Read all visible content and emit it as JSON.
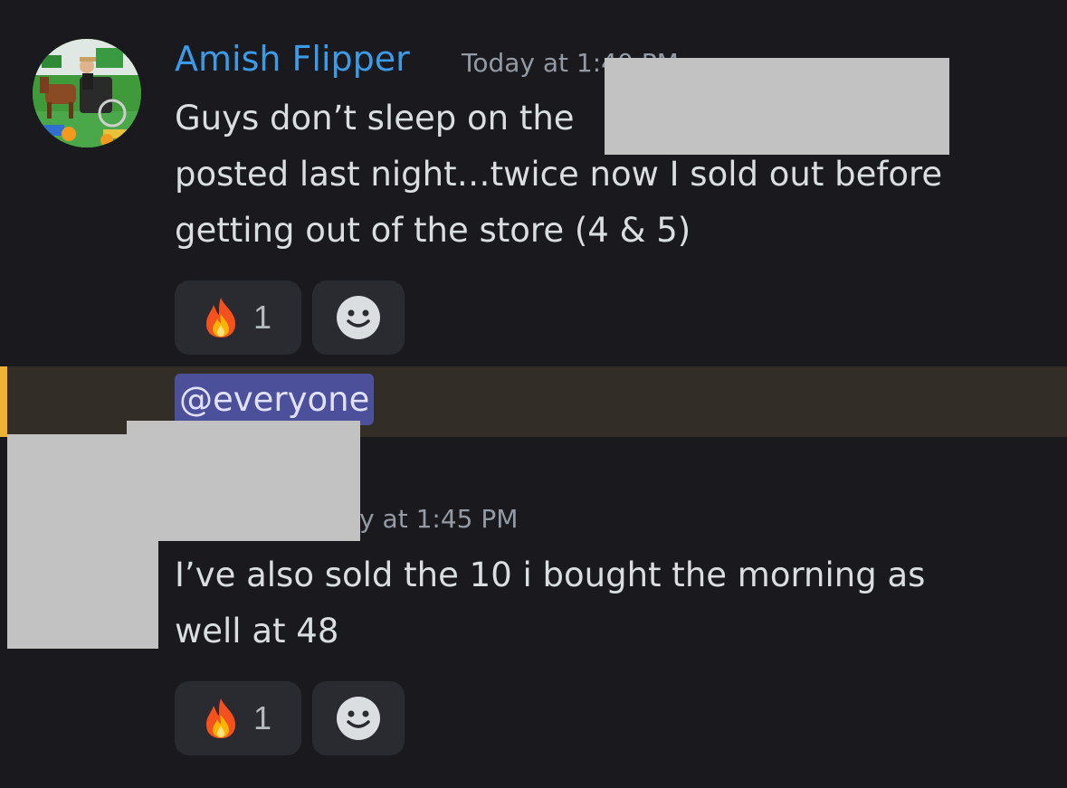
{
  "message1": {
    "author": "Amish Flipper",
    "timestamp": "Today at 1:40 PM",
    "line1": "Guys don’t sleep on the",
    "line2": "posted last night…twice now I sold out before",
    "line3": "getting out of the store (4 & 5)",
    "reaction": {
      "emoji": "fire",
      "count": "1"
    }
  },
  "mention": {
    "label": "@everyone"
  },
  "message2": {
    "timestamp": "oday at 1:45 PM",
    "line1": "I’ve also sold the 10 i bought the morning as",
    "line2": "well at 48",
    "reaction": {
      "emoji": "fire",
      "count": "1"
    }
  },
  "icons": {
    "fire": "fire-emoji-icon",
    "add_reaction": "smiley-add-reaction-icon"
  },
  "colors": {
    "background": "#1a1a1e",
    "author": "#3b9be6",
    "mention_bg": "#4c4f9a",
    "highlight_bar": "#f0b232",
    "redaction": "#c2c2c2"
  }
}
